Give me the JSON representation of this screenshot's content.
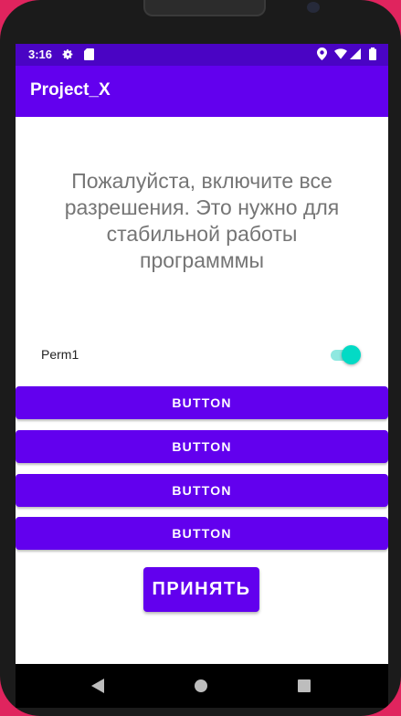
{
  "status_bar": {
    "time": "3:16",
    "icons": [
      "settings-icon",
      "sd-card-icon",
      "location-icon",
      "wifi-icon",
      "signal-icon",
      "battery-icon"
    ],
    "background": "#4a04c4"
  },
  "app_bar": {
    "title": "Project_X",
    "background": "#6200ee"
  },
  "main": {
    "message": "Пожалуйста, включите все разрешения. Это нужно для стабильной работы программмы",
    "permission": {
      "label": "Perm1",
      "enabled": true,
      "accent": "#03dac5"
    },
    "buttons": [
      {
        "label": "BUTTON"
      },
      {
        "label": "BUTTON"
      },
      {
        "label": "BUTTON"
      },
      {
        "label": "BUTTON"
      }
    ],
    "accept_label": "ПРИНЯТЬ"
  },
  "nav_bar": {
    "icons": [
      "back-icon",
      "home-icon",
      "recents-icon"
    ]
  },
  "colors": {
    "primary": "#6200ee",
    "primary_dark": "#4a04c4",
    "accent": "#03dac5",
    "outer_background": "#e0245e"
  }
}
